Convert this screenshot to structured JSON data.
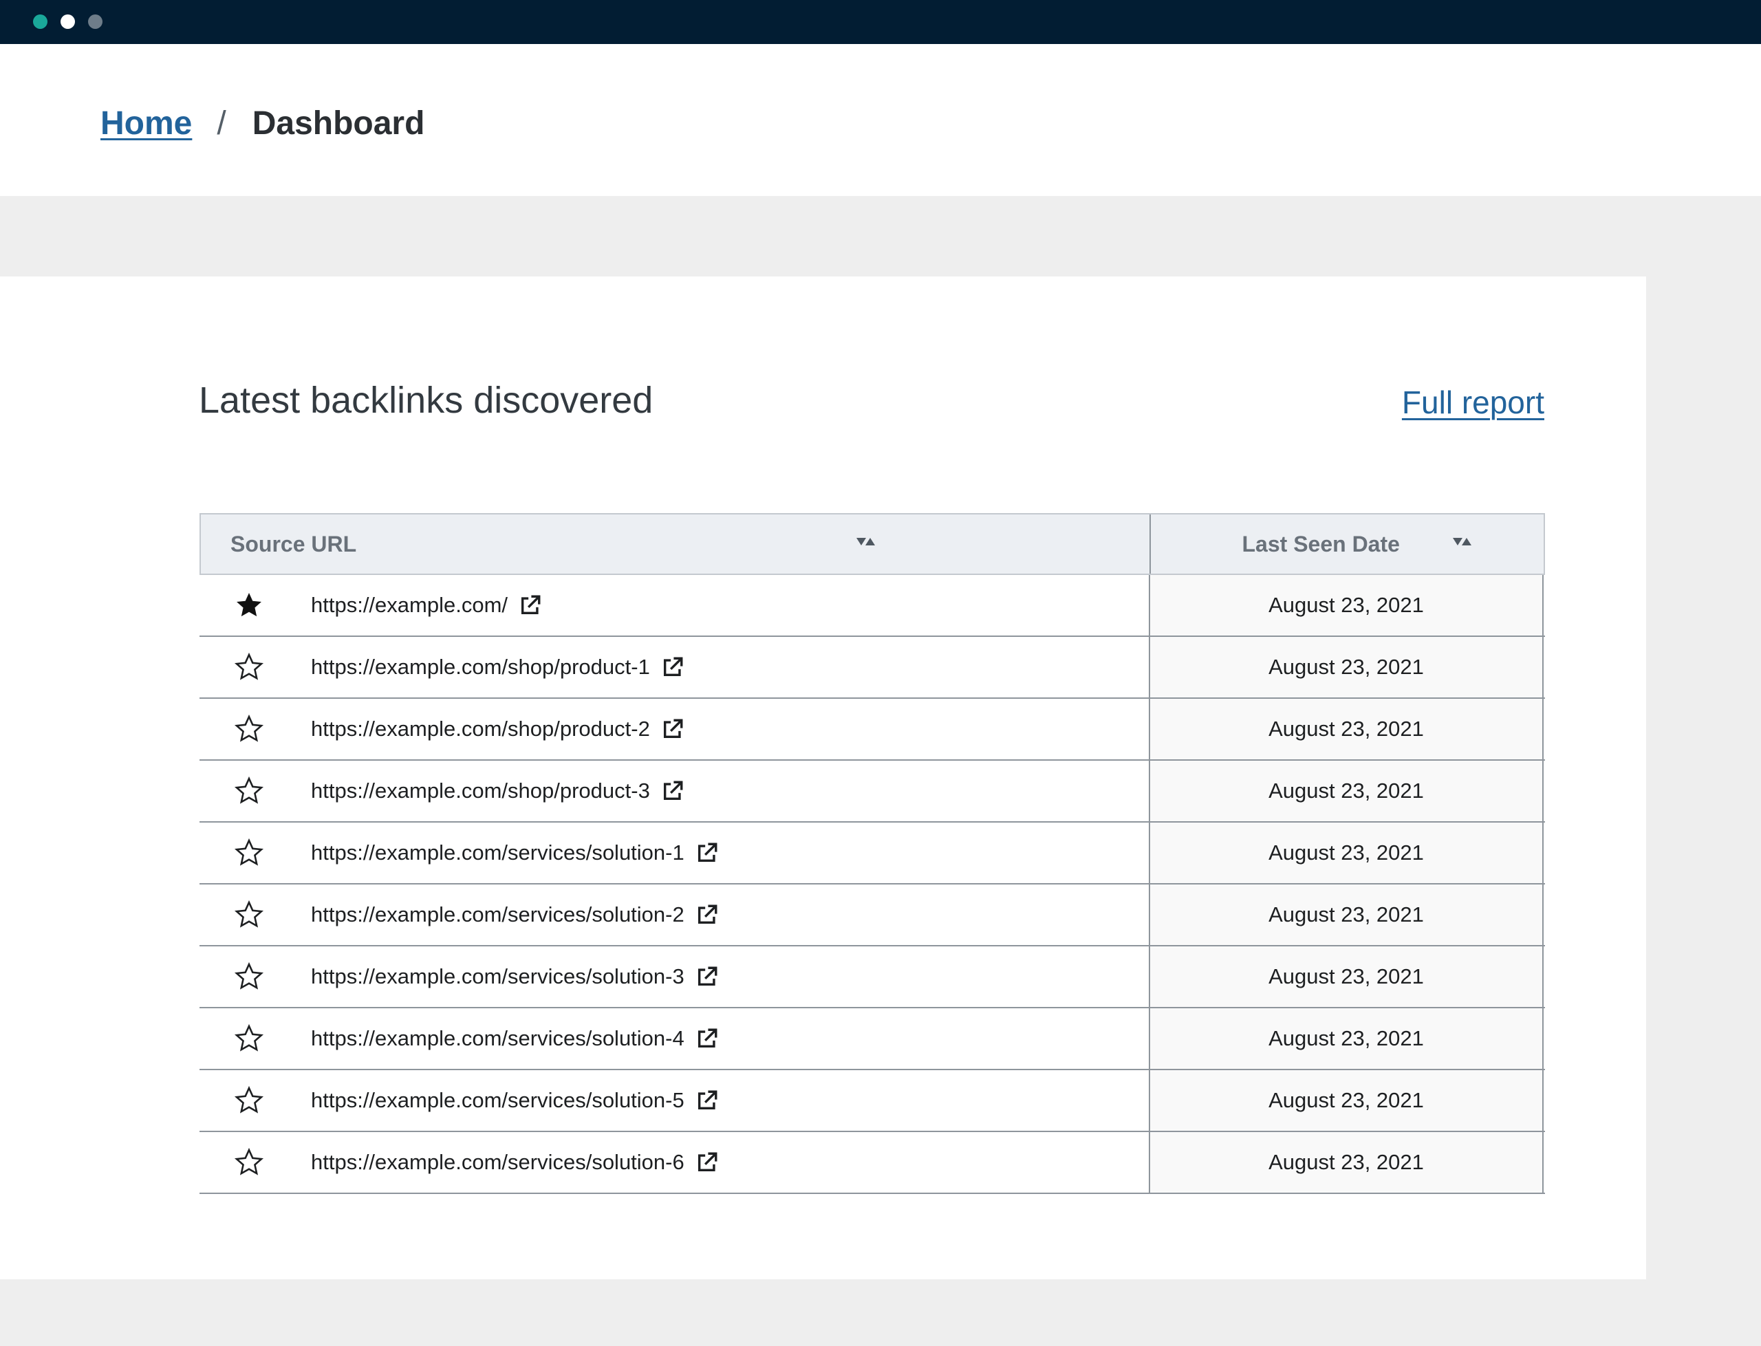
{
  "window": {
    "controls": [
      "close-dot",
      "minimize-dot",
      "zoom-dot"
    ]
  },
  "breadcrumb": {
    "home": "Home",
    "separator": "/",
    "current": "Dashboard"
  },
  "card": {
    "title": "Latest backlinks discovered",
    "full_report": "Full report"
  },
  "table": {
    "columns": {
      "source_url": "Source URL",
      "last_seen": "Last Seen Date"
    },
    "rows": [
      {
        "starred": true,
        "url": "https://example.com/",
        "date": "August 23, 2021"
      },
      {
        "starred": false,
        "url": "https://example.com/shop/product-1",
        "date": "August 23, 2021"
      },
      {
        "starred": false,
        "url": "https://example.com/shop/product-2",
        "date": "August 23, 2021"
      },
      {
        "starred": false,
        "url": "https://example.com/shop/product-3",
        "date": "August 23, 2021"
      },
      {
        "starred": false,
        "url": "https://example.com/services/solution-1",
        "date": "August 23, 2021"
      },
      {
        "starred": false,
        "url": "https://example.com/services/solution-2",
        "date": "August 23, 2021"
      },
      {
        "starred": false,
        "url": "https://example.com/services/solution-3",
        "date": "August 23, 2021"
      },
      {
        "starred": false,
        "url": "https://example.com/services/solution-4",
        "date": "August 23, 2021"
      },
      {
        "starred": false,
        "url": "https://example.com/services/solution-5",
        "date": "August 23, 2021"
      },
      {
        "starred": false,
        "url": "https://example.com/services/solution-6",
        "date": "August 23, 2021"
      }
    ]
  },
  "icons": {
    "star_filled": "star-filled-icon",
    "star_outline": "star-outline-icon",
    "external_link": "external-link-icon",
    "sort": "sort-icon"
  },
  "colors": {
    "titlebar": "#021d33",
    "link": "#22639b",
    "dot_teal": "#1aa89a"
  }
}
